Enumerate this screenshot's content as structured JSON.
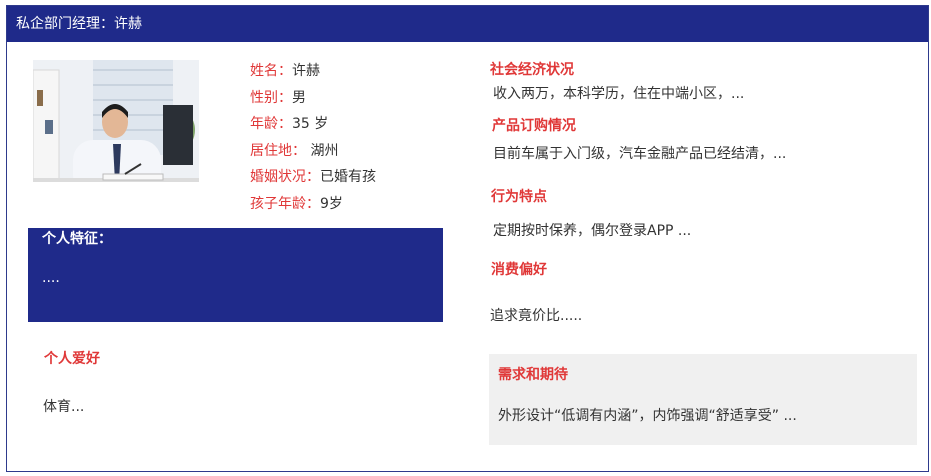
{
  "header": {
    "title": "私企部门经理：许赫"
  },
  "profile": {
    "name_label": "姓名：",
    "name_value": "许赫",
    "gender_label": "性别：",
    "gender_value": "男",
    "age_label": "年龄：",
    "age_value": "35 岁",
    "residence_label": "居住地：",
    "residence_value": " 湖州",
    "marital_label": "婚姻状况：",
    "marital_value": "已婚有孩",
    "child_age_label": "孩子年龄：",
    "child_age_value": "9岁"
  },
  "traits": {
    "title": "个人特征：",
    "text": "...."
  },
  "hobby": {
    "title": "个人爱好",
    "text": "体育..."
  },
  "socio": {
    "title": "社会经济状况",
    "text": "收入两万，本科学历，住在中端小区，..."
  },
  "product": {
    "title": "产品订购情况",
    "text": "目前车属于入门级，汽车金融产品已经结清，..."
  },
  "behavior": {
    "title": "行为特点",
    "text": "定期按时保养，偶尔登录APP ..."
  },
  "consumption": {
    "title": "消费偏好",
    "text": "追求竟价比....."
  },
  "needs": {
    "title": "需求和期待",
    "text": "外形设计“低调有内涵”，内饰强调“舒适享受” ..."
  },
  "colors": {
    "navy": "#1f2a8a",
    "accent_red": "#e03838",
    "panel_gray": "#f0f0f0"
  }
}
